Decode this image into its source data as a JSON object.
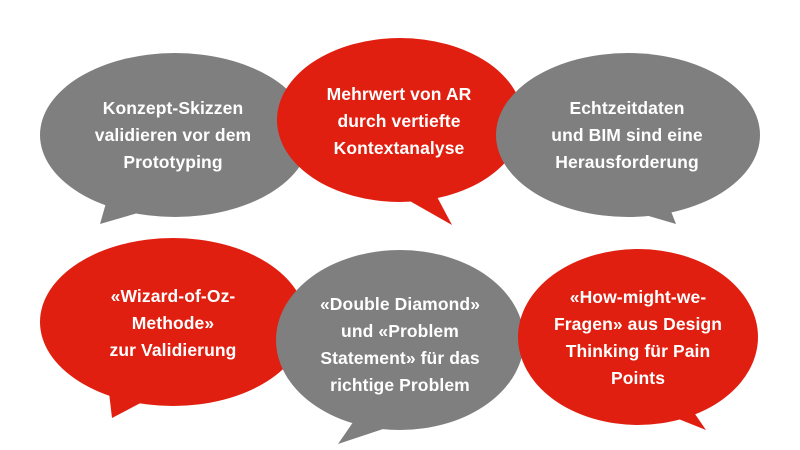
{
  "colors": {
    "gray": "#7f7f7f",
    "red": "#e01f10",
    "text": "#ffffff",
    "background": "#ffffff"
  },
  "bubbles": [
    {
      "color": "gray",
      "lines": [
        "Konzept-Skizzen",
        "validieren vor dem",
        "Prototyping"
      ]
    },
    {
      "color": "red",
      "lines": [
        "Mehrwert von AR",
        "durch vertiefte",
        "Kontextanalyse"
      ]
    },
    {
      "color": "gray",
      "lines": [
        "Echtzeitdaten",
        "und BIM sind eine",
        "Herausforderung"
      ]
    },
    {
      "color": "red",
      "lines": [
        "«Wizard-of-Oz-",
        "Methode»",
        "zur Validierung"
      ]
    },
    {
      "color": "gray",
      "lines": [
        "«Double Diamond»",
        "und «Problem",
        "Statement» für das",
        "richtige Problem"
      ]
    },
    {
      "color": "red",
      "lines": [
        "«How-might-we-",
        "Fragen» aus Design",
        "Thinking für Pain",
        "Points"
      ]
    }
  ]
}
